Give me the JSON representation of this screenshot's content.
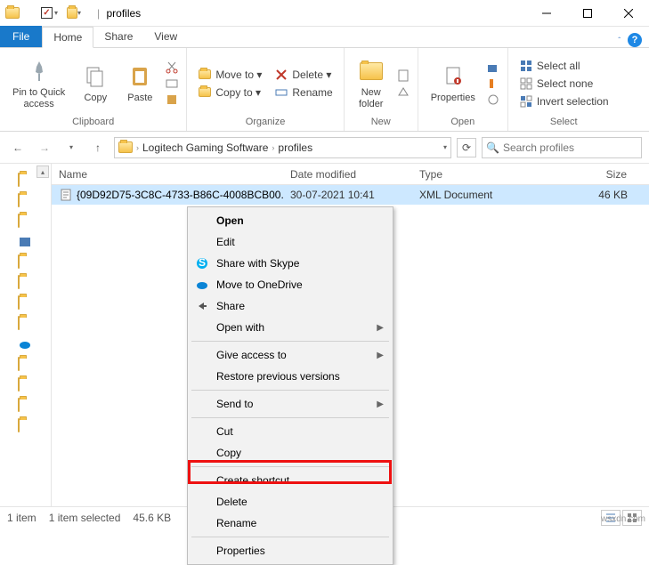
{
  "titlebar": {
    "title": "profiles",
    "separator": "|"
  },
  "tabs": {
    "file": "File",
    "home": "Home",
    "share": "Share",
    "view": "View"
  },
  "ribbon": {
    "clipboard": {
      "label": "Clipboard",
      "pin": "Pin to Quick\naccess",
      "copy": "Copy",
      "paste": "Paste"
    },
    "organize": {
      "label": "Organize",
      "move_to": "Move to ▾",
      "copy_to": "Copy to ▾",
      "delete": "Delete ▾",
      "rename": "Rename"
    },
    "new": {
      "label": "New",
      "new_folder": "New\nfolder"
    },
    "open": {
      "label": "Open",
      "properties": "Properties"
    },
    "select": {
      "label": "Select",
      "all": "Select all",
      "none": "Select none",
      "invert": "Invert selection"
    }
  },
  "address": {
    "crumb1": "Logitech Gaming Software",
    "crumb2": "profiles"
  },
  "search": {
    "placeholder": "Search profiles"
  },
  "columns": {
    "name": "Name",
    "date": "Date modified",
    "type": "Type",
    "size": "Size"
  },
  "rows": [
    {
      "name": "{09D92D75-3C8C-4733-B86C-4008BCB00...",
      "date": "30-07-2021 10:41",
      "type": "XML Document",
      "size": "46 KB"
    }
  ],
  "context_menu": {
    "open": "Open",
    "edit": "Edit",
    "skype": "Share with Skype",
    "onedrive": "Move to OneDrive",
    "share": "Share",
    "open_with": "Open with",
    "give_access": "Give access to",
    "restore": "Restore previous versions",
    "send_to": "Send to",
    "cut": "Cut",
    "copy": "Copy",
    "shortcut": "Create shortcut",
    "delete": "Delete",
    "rename": "Rename",
    "properties": "Properties"
  },
  "status": {
    "count": "1 item",
    "selected": "1 item selected",
    "size": "45.6 KB"
  },
  "watermark": "wsxdn.com"
}
